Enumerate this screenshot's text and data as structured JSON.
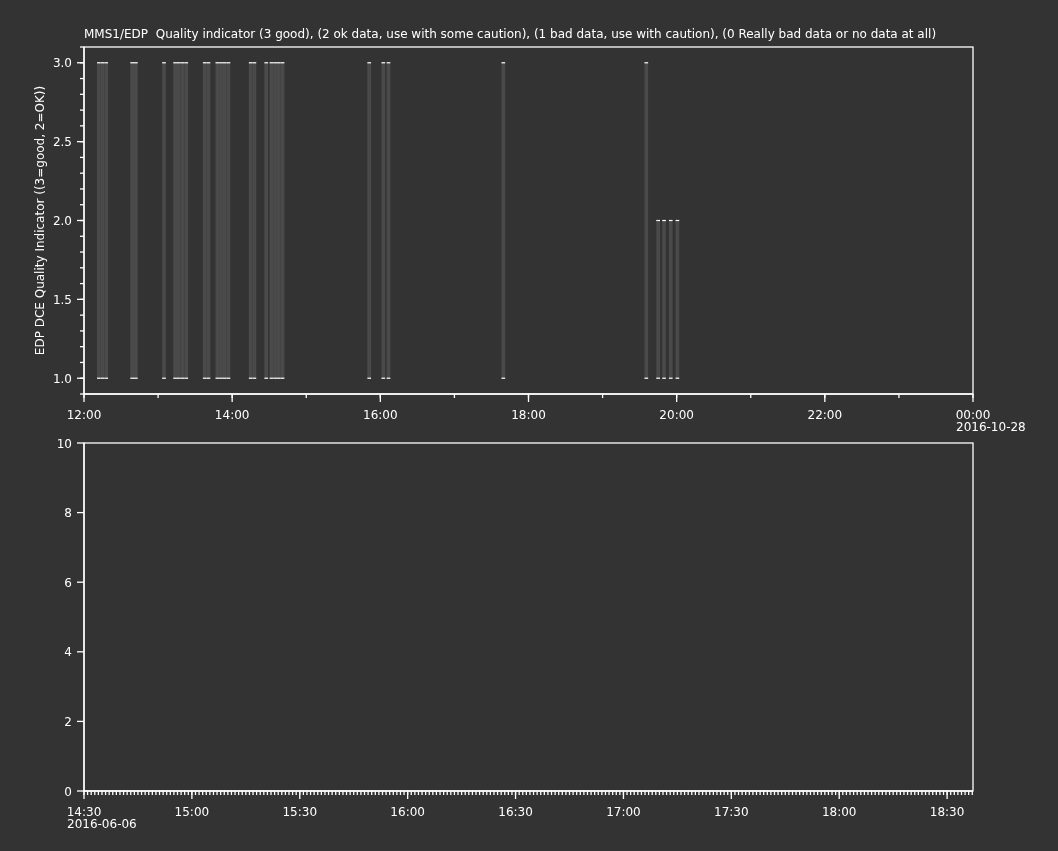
{
  "plots": [
    {
      "chart_data": {
        "type": "area",
        "title": "MMS1/EDP  Quality indicator (3 good), (2 ok data, use with some caution), (1 bad data, use with caution), (0 Really bad data or no data at all)",
        "ylabel": "EDP DCE Quality Indicator ((3=good, 2=OK))",
        "x": [
          12.2,
          12.25,
          12.3,
          12.65,
          12.7,
          13.08,
          13.23,
          13.28,
          13.33,
          13.38,
          13.63,
          13.68,
          13.8,
          13.85,
          13.9,
          13.95,
          14.25,
          14.3,
          14.46,
          14.53,
          14.58,
          14.63,
          14.68,
          15.85,
          16.04,
          16.11,
          17.66,
          19.59,
          19.75,
          19.83,
          19.92,
          20.01
        ],
        "values": [
          3,
          3,
          3,
          3,
          3,
          3,
          3,
          3,
          3,
          3,
          3,
          3,
          3,
          3,
          3,
          3,
          3,
          3,
          3,
          3,
          3,
          3,
          3,
          3,
          3,
          3,
          3,
          3,
          2,
          2,
          2,
          2
        ],
        "xlim": [
          12,
          24
        ],
        "ylim": [
          0.9,
          3.1
        ],
        "xticks": [
          {
            "value": 12,
            "label": "12:00"
          },
          {
            "value": 14,
            "label": "14:00"
          },
          {
            "value": 16,
            "label": "16:00"
          },
          {
            "value": 18,
            "label": "18:00"
          },
          {
            "value": 20,
            "label": "20:00"
          },
          {
            "value": 22,
            "label": "22:00"
          },
          {
            "value": 24,
            "label": "00:00"
          }
        ],
        "yticks": [
          {
            "value": 1,
            "label": "1.0"
          },
          {
            "value": 1.5,
            "label": "1.5"
          },
          {
            "value": 2,
            "label": "2.0"
          },
          {
            "value": 2.5,
            "label": "2.5"
          },
          {
            "value": 3,
            "label": "3.0"
          }
        ],
        "annotations": [
          "2016-10-28"
        ]
      }
    },
    {
      "chart_data": {
        "type": "line",
        "xlim": [
          14.5,
          18.62
        ],
        "ylim": [
          0,
          10
        ],
        "xticks": [
          {
            "value": 14.5,
            "label": "14:30"
          },
          {
            "value": 15,
            "label": "15:00"
          },
          {
            "value": 15.5,
            "label": "15:30"
          },
          {
            "value": 16,
            "label": "16:00"
          },
          {
            "value": 16.5,
            "label": "16:30"
          },
          {
            "value": 17,
            "label": "17:00"
          },
          {
            "value": 17.5,
            "label": "17:30"
          },
          {
            "value": 18,
            "label": "18:00"
          },
          {
            "value": 18.5,
            "label": "18:30"
          }
        ],
        "yticks": [
          0,
          2,
          4,
          6,
          8,
          10
        ],
        "annotations": [
          "2016-06-06"
        ]
      }
    }
  ]
}
